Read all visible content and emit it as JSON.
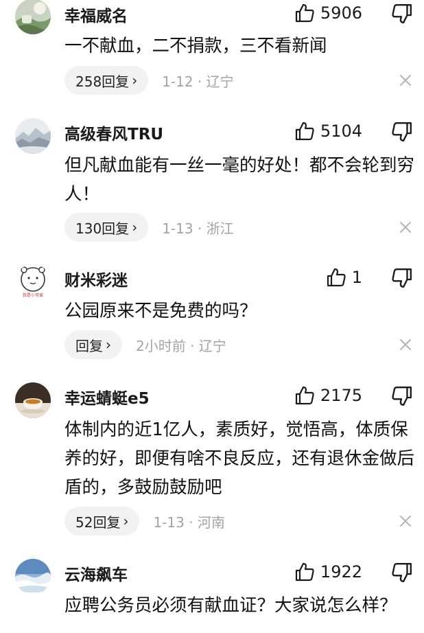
{
  "comments": [
    {
      "username": "幸福威名",
      "likes": "5906",
      "text": "一不献血，二不捐款，三不看新闻",
      "reply_label": "258回复",
      "date": "1-12",
      "separator": "·",
      "location": "辽宁",
      "avatar_icon": "landscape-avatar-icon"
    },
    {
      "username": "高级春风TRU",
      "likes": "5104",
      "text": "但凡献血能有一丝一毫的好处！都不会轮到穷人！",
      "reply_label": "130回复",
      "date": "1-13",
      "separator": "·",
      "location": "浙江",
      "avatar_icon": "mountain-avatar-icon"
    },
    {
      "username": "财米彩迷",
      "likes": "1",
      "text": "公园原来不是免费的吗？",
      "reply_label": "回复",
      "date": "2小时前",
      "separator": "·",
      "location": "辽宁",
      "avatar_icon": "cartoon-bear-avatar-icon",
      "avatar_caption": "我是小可爱"
    },
    {
      "username": "幸运蜻蜓e5",
      "likes": "2175",
      "text": "体制内的近1亿人，素质好，觉悟高，体质保养的好，即便有啥不良反应，还有退休金做后盾的，多鼓励鼓励吧",
      "reply_label": "52回复",
      "date": "1-13",
      "separator": "·",
      "location": "河南",
      "avatar_icon": "tea-cup-avatar-icon"
    },
    {
      "username": "云海飙车",
      "likes": "1922",
      "text": "应聘公务员必须有献血证？大家说怎么样？",
      "avatar_icon": "sea-of-clouds-avatar-icon"
    }
  ],
  "icons": {
    "like": "thumbs-up-icon",
    "dislike": "thumbs-down-icon",
    "close": "close-icon",
    "chevron": "›"
  },
  "colors": {
    "text": "#111111",
    "meta": "#a3a3a3",
    "pill": "#f2f2f2"
  }
}
